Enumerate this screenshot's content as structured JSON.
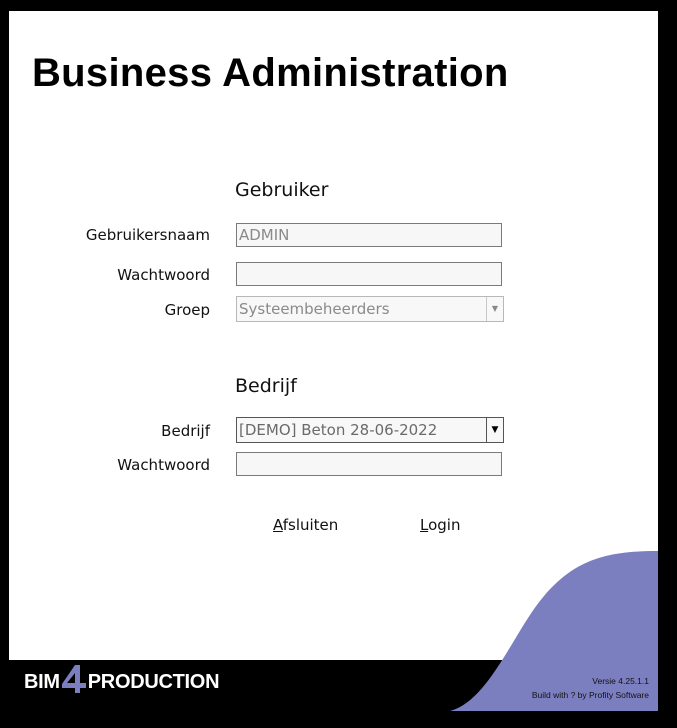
{
  "app": {
    "title": "Business Administration"
  },
  "user_section": {
    "heading": "Gebruiker",
    "username_label": "Gebruikersnaam",
    "username_value": "ADMIN",
    "password_label": "Wachtwoord",
    "password_value": "",
    "group_label": "Groep",
    "group_value": "Systeembeheerders"
  },
  "company_section": {
    "heading": "Bedrijf",
    "company_label": "Bedrijf",
    "company_value": "[DEMO] Beton 28-06-2022",
    "password_label": "Wachtwoord",
    "password_value": ""
  },
  "actions": {
    "exit_accesskey": "A",
    "exit_rest": "fsluiten",
    "login_accesskey": "L",
    "login_rest": "ogin"
  },
  "footer": {
    "logo_left": "BIM",
    "logo_mid": "4",
    "logo_right": "PRODUCTION",
    "version": "Versie 4.25.1.1",
    "build": "Build with ? by Profity Software"
  },
  "colors": {
    "accent_wave": "#7b7fc0",
    "background": "#ffffff",
    "frame": "#000000"
  },
  "icons": {
    "dropdown": "triangle-down-icon"
  }
}
